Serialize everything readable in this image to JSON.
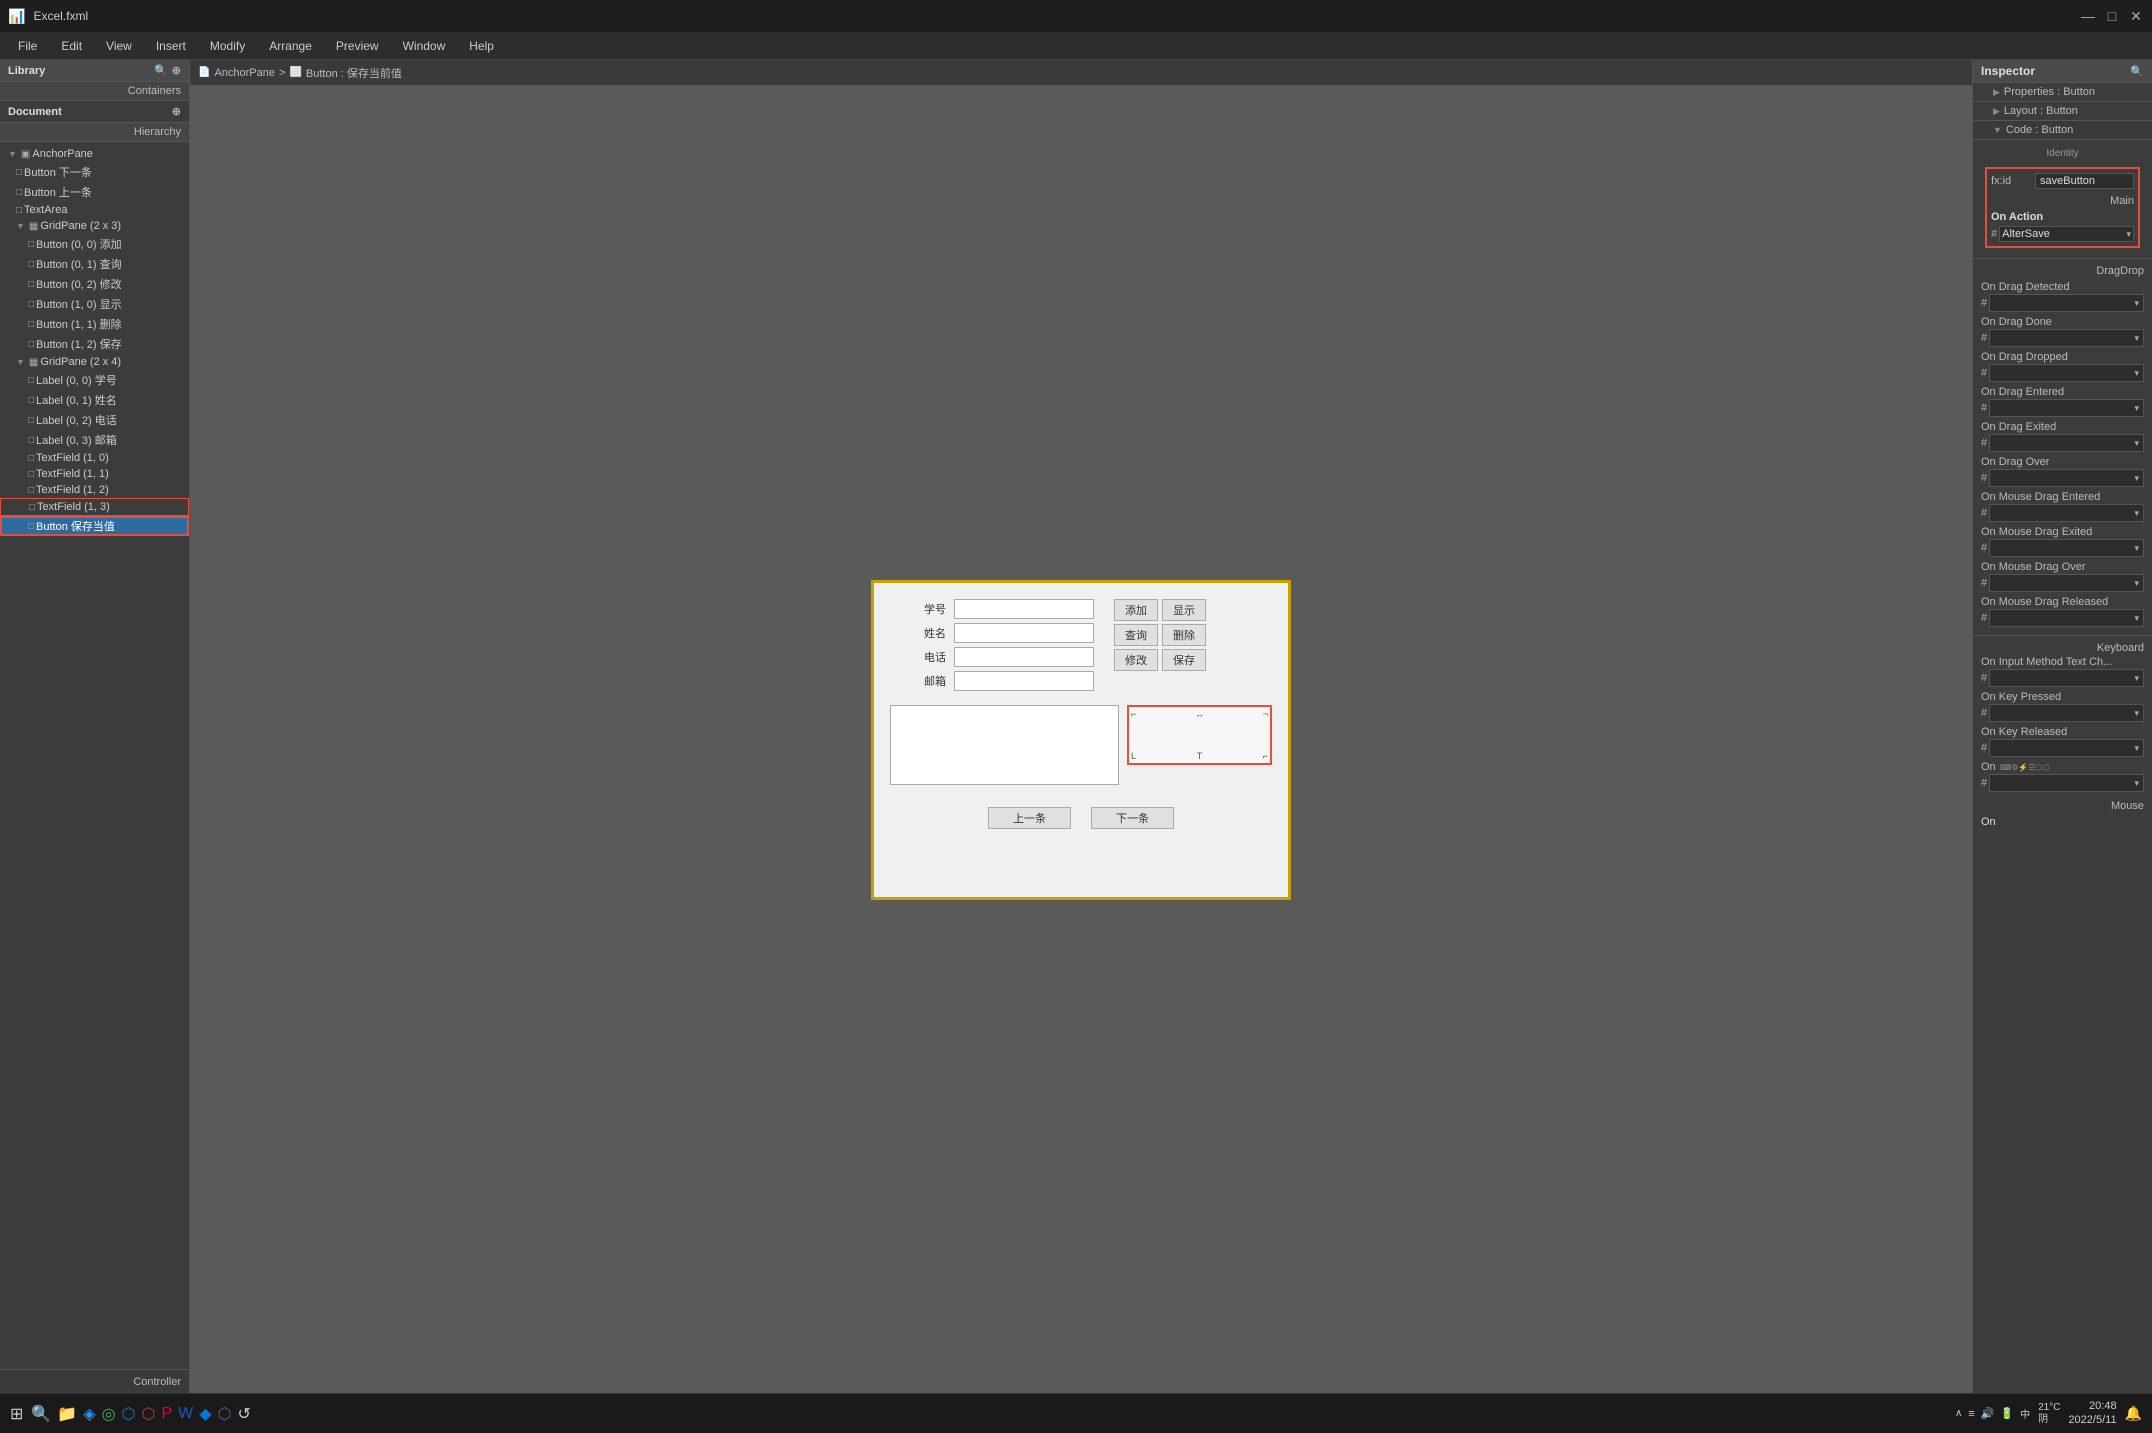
{
  "titlebar": {
    "title": "Excel.fxml",
    "minimize": "—",
    "maximize": "□",
    "close": "✕"
  },
  "menubar": {
    "items": [
      "File",
      "Edit",
      "View",
      "Insert",
      "Modify",
      "Arrange",
      "Preview",
      "Window",
      "Help"
    ]
  },
  "library": {
    "title": "Library",
    "containers_label": "Containers"
  },
  "document": {
    "title": "Document",
    "hierarchy_label": "Hierarchy"
  },
  "hierarchy": {
    "items": [
      {
        "id": "anchorpane",
        "label": "AnchorPane",
        "indent": 0,
        "icon": "▣",
        "expand": "▼"
      },
      {
        "id": "btn-xia",
        "label": "Button 下一条",
        "indent": 1,
        "icon": "▣",
        "expand": ""
      },
      {
        "id": "btn-shang",
        "label": "Button 上一条",
        "indent": 1,
        "icon": "▣",
        "expand": ""
      },
      {
        "id": "textarea",
        "label": "TextArea",
        "indent": 1,
        "icon": "▣",
        "expand": ""
      },
      {
        "id": "gridpane-2x3",
        "label": "GridPane (2 x 3)",
        "indent": 1,
        "icon": "▦",
        "expand": "▼"
      },
      {
        "id": "btn-00",
        "label": "Button (0, 0) 添加",
        "indent": 2,
        "icon": "▣",
        "expand": ""
      },
      {
        "id": "btn-01",
        "label": "Button (0, 1) 查询",
        "indent": 2,
        "icon": "▣",
        "expand": ""
      },
      {
        "id": "btn-02",
        "label": "Button (0, 2) 修改",
        "indent": 2,
        "icon": "▣",
        "expand": ""
      },
      {
        "id": "btn-10",
        "label": "Button (1, 0) 显示",
        "indent": 2,
        "icon": "▣",
        "expand": ""
      },
      {
        "id": "btn-11",
        "label": "Button (1, 1) 删除",
        "indent": 2,
        "icon": "▣",
        "expand": ""
      },
      {
        "id": "btn-12",
        "label": "Button (1, 2) 保存",
        "indent": 2,
        "icon": "▣",
        "expand": ""
      },
      {
        "id": "gridpane-2x4",
        "label": "GridPane (2 x 4)",
        "indent": 1,
        "icon": "▦",
        "expand": "▼"
      },
      {
        "id": "lbl-00",
        "label": "Label (0, 0) 学号",
        "indent": 2,
        "icon": "▣",
        "expand": ""
      },
      {
        "id": "lbl-01",
        "label": "Label (0, 1) 姓名",
        "indent": 2,
        "icon": "▣",
        "expand": ""
      },
      {
        "id": "lbl-02",
        "label": "Label (0, 2) 电话",
        "indent": 2,
        "icon": "▣",
        "expand": ""
      },
      {
        "id": "lbl-03",
        "label": "Label (0, 3) 邮箱",
        "indent": 2,
        "icon": "▣",
        "expand": ""
      },
      {
        "id": "tf-10",
        "label": "TextField (1, 0)",
        "indent": 2,
        "icon": "▣",
        "expand": ""
      },
      {
        "id": "tf-11",
        "label": "TextField (1, 1)",
        "indent": 2,
        "icon": "▣",
        "expand": ""
      },
      {
        "id": "tf-12",
        "label": "TextField (1, 2)",
        "indent": 2,
        "icon": "▣",
        "expand": ""
      },
      {
        "id": "tf-13",
        "label": "TextField (1, 3)",
        "indent": 2,
        "icon": "▣",
        "expand": ""
      },
      {
        "id": "btn-save",
        "label": "Button 保存当值",
        "indent": 2,
        "icon": "▣",
        "expand": "",
        "selected": true,
        "highlighted": true
      }
    ]
  },
  "breadcrumb": {
    "parts": [
      "AnchorPane",
      ">",
      "Button : 保存当前值"
    ]
  },
  "preview": {
    "form_labels": [
      "学号",
      "姓名",
      "电话",
      "邮箱"
    ],
    "buttons_col1": [
      "添加",
      "查询",
      "修改"
    ],
    "buttons_col2": [
      "显示",
      "删除",
      "保存"
    ],
    "nav_prev": "上一条",
    "nav_next": "下一条"
  },
  "inspector": {
    "title": "Inspector",
    "search_placeholder": "🔍",
    "tabs": [
      {
        "label": "Properties : Button"
      },
      {
        "label": "Layout : Button"
      },
      {
        "label": "Code : Button"
      }
    ],
    "identity_label": "Identity",
    "fxid_label": "fx:id",
    "fxid_value": "saveButton",
    "main_label": "Main",
    "on_action_label": "On Action",
    "altersave_value": "AlterSave",
    "dragdrop_label": "DragDrop",
    "events": [
      {
        "label": "On Drag Detected",
        "value": "#"
      },
      {
        "label": "On Drag Done",
        "value": "#"
      },
      {
        "label": "On Drag Dropped",
        "value": "#"
      },
      {
        "label": "On Drag Entered",
        "value": "#"
      },
      {
        "label": "On Drag Exited",
        "value": "#"
      },
      {
        "label": "On Drag Over",
        "value": "#"
      },
      {
        "label": "On Mouse Drag Entered",
        "value": "#"
      },
      {
        "label": "On Mouse Drag Exited",
        "value": "#"
      },
      {
        "label": "On Mouse Drag Over",
        "value": "#"
      },
      {
        "label": "On Mouse Drag Released",
        "value": "#"
      }
    ],
    "keyboard_label": "Keyboard",
    "keyboard_events": [
      {
        "label": "On Input Method Text Ch...",
        "value": "#"
      },
      {
        "label": "On Key Pressed",
        "value": "#"
      },
      {
        "label": "On Key Released",
        "value": "#"
      }
    ],
    "on_label": "On",
    "mouse_label": "Mouse"
  },
  "controller": {
    "label": "Controller"
  },
  "taskbar": {
    "weather_temp": "21°C",
    "weather_condition": "阴",
    "time": "20:48",
    "date": "2022/5/11"
  }
}
